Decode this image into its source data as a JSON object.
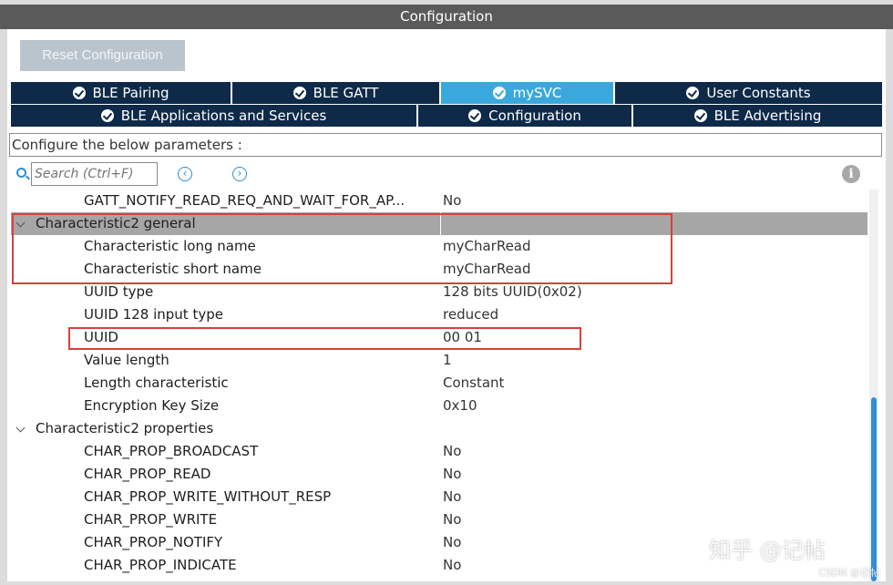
{
  "window": {
    "title": "Configuration"
  },
  "toolbar": {
    "reset_label": "Reset Configuration"
  },
  "tabs_row1": [
    {
      "label": "BLE Pairing"
    },
    {
      "label": "BLE GATT"
    },
    {
      "label": "mySVC",
      "active": true
    },
    {
      "label": "User Constants"
    }
  ],
  "tabs_row2": [
    {
      "label": "BLE Applications and Services"
    },
    {
      "label": "Configuration"
    },
    {
      "label": "BLE Advertising"
    }
  ],
  "description": "Configure the below parameters :",
  "search": {
    "placeholder": "Search (Ctrl+F)",
    "prev_icon": "chevron-left-circle-icon",
    "next_icon": "chevron-right-circle-icon"
  },
  "params": [
    {
      "name": "GATT_NOTIFY_READ_REQ_AND_WAIT_FOR_AP...",
      "value": "No"
    },
    {
      "group": true,
      "name": "Characteristic2 general",
      "value": ""
    },
    {
      "name": "Characteristic long name",
      "value": "myCharRead"
    },
    {
      "name": "Characteristic short name",
      "value": "myCharRead"
    },
    {
      "name": "UUID type",
      "value": "128 bits UUID(0x02)"
    },
    {
      "name": "UUID 128 input type",
      "value": "reduced"
    },
    {
      "name": "UUID",
      "value": "00 01"
    },
    {
      "name": "Value length",
      "value": "1"
    },
    {
      "name": "Length characteristic",
      "value": "Constant"
    },
    {
      "name": "Encryption Key Size",
      "value": "0x10"
    },
    {
      "group": true,
      "name": "Characteristic2 properties",
      "value": ""
    },
    {
      "name": "CHAR_PROP_BROADCAST",
      "value": "No"
    },
    {
      "name": "CHAR_PROP_READ",
      "value": "No"
    },
    {
      "name": "CHAR_PROP_WRITE_WITHOUT_RESP",
      "value": "No"
    },
    {
      "name": "CHAR_PROP_WRITE",
      "value": "No"
    },
    {
      "name": "CHAR_PROP_NOTIFY",
      "value": "No"
    },
    {
      "name": "CHAR_PROP_INDICATE",
      "value": "No"
    }
  ],
  "watermark": {
    "main": "知乎 @记帖",
    "sub": "CSDN @记帖"
  },
  "colors": {
    "tab_bg": "#0e2a48",
    "tab_active": "#39a8dc",
    "highlight_box": "#d9403a",
    "group_row": "#a6a6a6"
  }
}
